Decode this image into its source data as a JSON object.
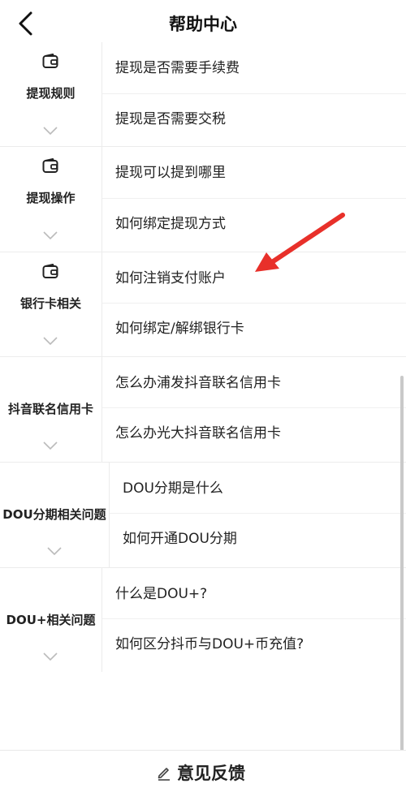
{
  "header": {
    "title": "帮助中心"
  },
  "groups": [
    {
      "label": "提现规则",
      "questions": [
        "提现是否需要手续费",
        "提现是否需要交税"
      ],
      "has_icon": true
    },
    {
      "label": "提现操作",
      "questions": [
        "提现可以提到哪里",
        "如何绑定提现方式"
      ],
      "has_icon": true
    },
    {
      "label": "银行卡相关",
      "questions": [
        "如何注销支付账户",
        "如何绑定/解绑银行卡"
      ],
      "has_icon": true
    },
    {
      "label": "抖音联名信用卡",
      "questions": [
        "怎么办浦发抖音联名信用卡",
        "怎么办光大抖音联名信用卡"
      ],
      "has_icon": false
    },
    {
      "label": "DOU分期相关问题",
      "questions": [
        "DOU分期是什么",
        "如何开通DOU分期"
      ],
      "has_icon": false
    },
    {
      "label": "DOU+相关问题",
      "questions": [
        "什么是DOU+?",
        "如何区分抖币与DOU+币充值?"
      ],
      "has_icon": false
    }
  ],
  "footer": {
    "feedback_label": "意见反馈"
  },
  "colors": {
    "arrow": "#e8302a",
    "text": "#222222",
    "divider": "#ececec"
  }
}
